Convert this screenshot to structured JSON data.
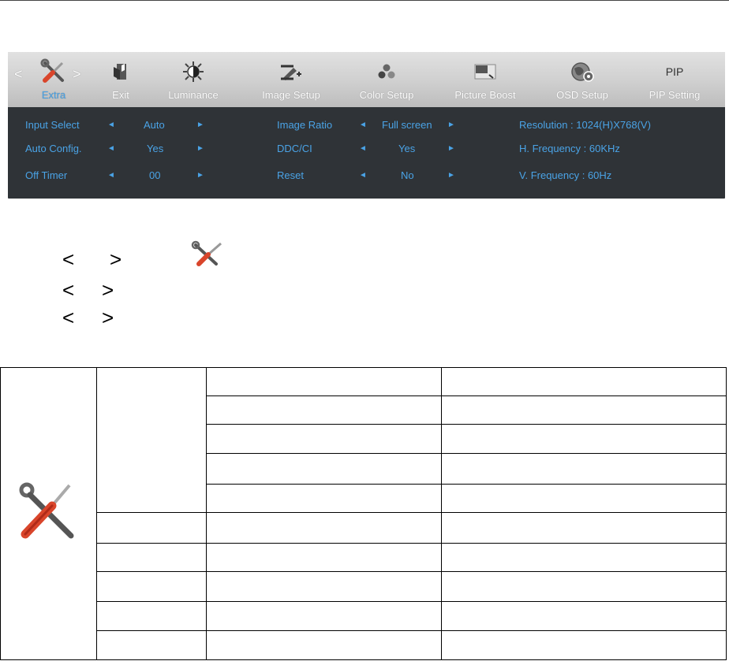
{
  "osd": {
    "tabs": [
      {
        "label": "Extra",
        "icon": "tools-icon",
        "active": true
      },
      {
        "label": "Exit",
        "icon": "exit-icon"
      },
      {
        "label": "Luminance",
        "icon": "sun-contrast-icon"
      },
      {
        "label": "Image Setup",
        "icon": "image-setup-icon"
      },
      {
        "label": "Color Setup",
        "icon": "color-dots-icon"
      },
      {
        "label": "Picture Boost",
        "icon": "picture-boost-icon"
      },
      {
        "label": "OSD Setup",
        "icon": "globe-icon"
      },
      {
        "label": "PIP Setting",
        "icon_text": "PIP"
      }
    ],
    "nav_left": "<",
    "nav_right": ">",
    "left_group": [
      {
        "label": "Input Select",
        "value": "Auto"
      },
      {
        "label": "Auto Config.",
        "value": "Yes"
      },
      {
        "label": "Off Timer",
        "value": "00"
      }
    ],
    "mid_group": [
      {
        "label": "Image Ratio",
        "value": "Full screen"
      },
      {
        "label": "DDC/CI",
        "value": "Yes"
      },
      {
        "label": "Reset",
        "value": "No"
      }
    ],
    "info": [
      "Resolution : 1024(H)X768(V)",
      "H. Frequency : 60KHz",
      "V. Frequency : 60Hz"
    ],
    "arrow_left": "◄",
    "arrow_right": "►"
  },
  "steps": {
    "lt": "<",
    "gt": ">"
  },
  "colors": {
    "accent": "#4aa3e6",
    "panel": "#2f3337",
    "tool_red": "#d9452b"
  }
}
